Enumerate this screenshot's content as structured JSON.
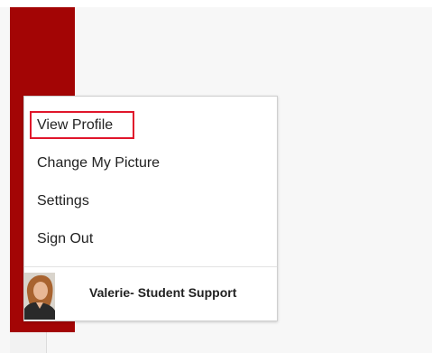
{
  "menu": {
    "items": [
      {
        "label": "View Profile"
      },
      {
        "label": "Change My Picture"
      },
      {
        "label": "Settings"
      },
      {
        "label": "Sign Out"
      }
    ]
  },
  "user": {
    "name": "Valerie- Student Support"
  },
  "colors": {
    "sidebar": "#a30505",
    "highlight": "#e0162b"
  }
}
